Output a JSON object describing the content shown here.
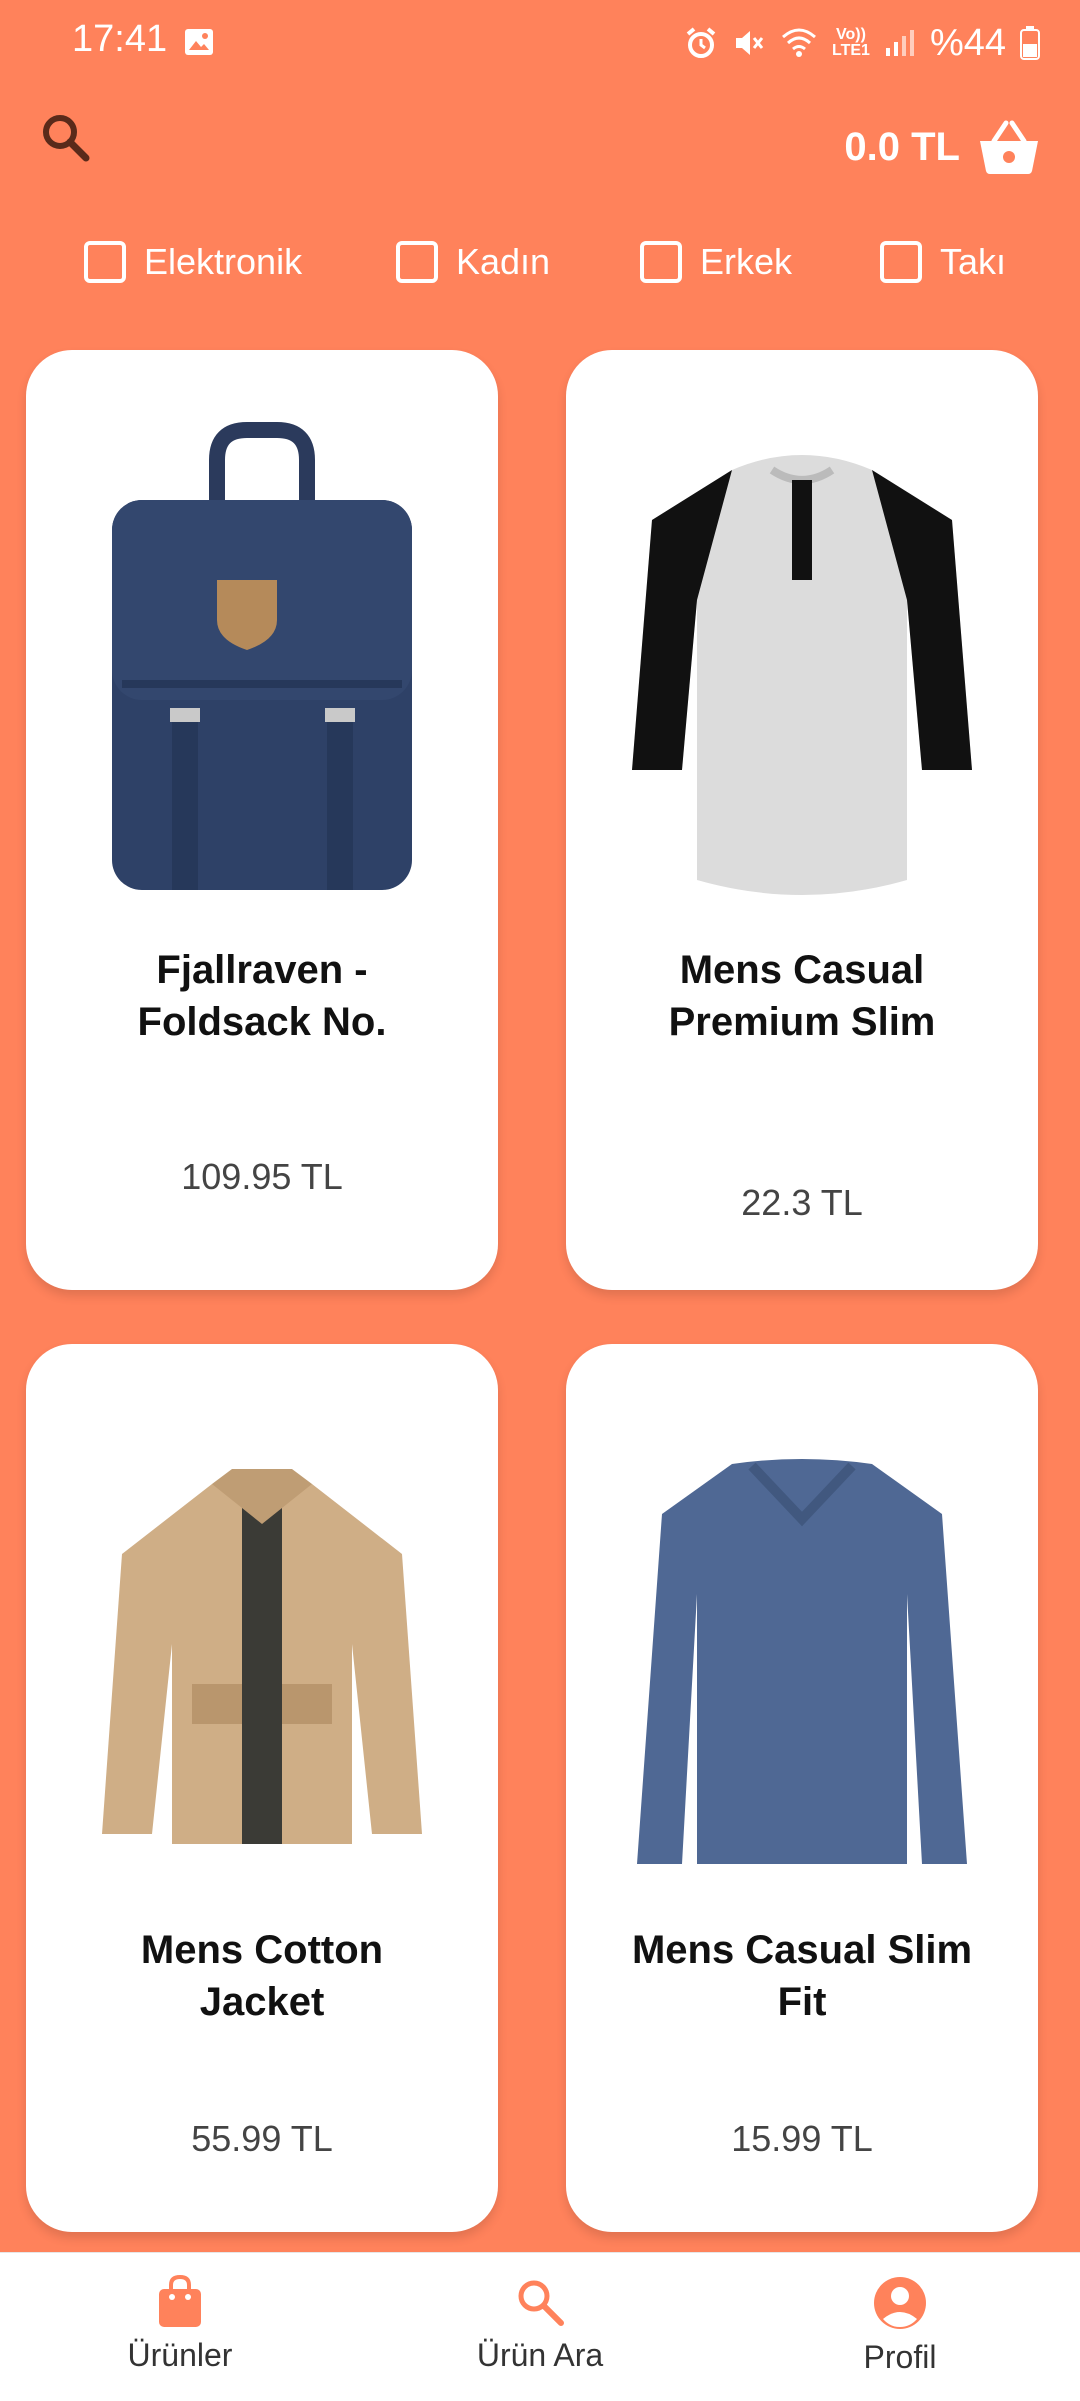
{
  "status": {
    "time": "17:41",
    "battery": "%44",
    "network_label_top": "Vo))",
    "network_label_bottom": "LTE1"
  },
  "header": {
    "cart_total": "0.0 TL"
  },
  "filters": [
    {
      "label": "Elektronik",
      "checked": false
    },
    {
      "label": "Kadın",
      "checked": false
    },
    {
      "label": "Erkek",
      "checked": false
    },
    {
      "label": "Takı",
      "checked": false
    }
  ],
  "products": [
    {
      "title": "Fjallraven - Foldsack No.",
      "price": "109.95 TL",
      "image": "navy-backpack"
    },
    {
      "title": "Mens Casual Premium Slim",
      "price": "22.3 TL",
      "image": "raglan-tshirt"
    },
    {
      "title": "Mens Cotton Jacket",
      "price": "55.99 TL",
      "image": "beige-jacket"
    },
    {
      "title": "Mens Casual Slim Fit",
      "price": "15.99 TL",
      "image": "blue-longsleeve"
    }
  ],
  "bottom_nav": [
    {
      "label": "Ürünler",
      "icon": "shopping-bag-icon"
    },
    {
      "label": "Ürün Ara",
      "icon": "search-icon"
    },
    {
      "label": "Profil",
      "icon": "account-circle-icon"
    }
  ],
  "colors": {
    "background": "#FF825B",
    "accent": "#FF825B",
    "card": "#FFFFFF"
  }
}
